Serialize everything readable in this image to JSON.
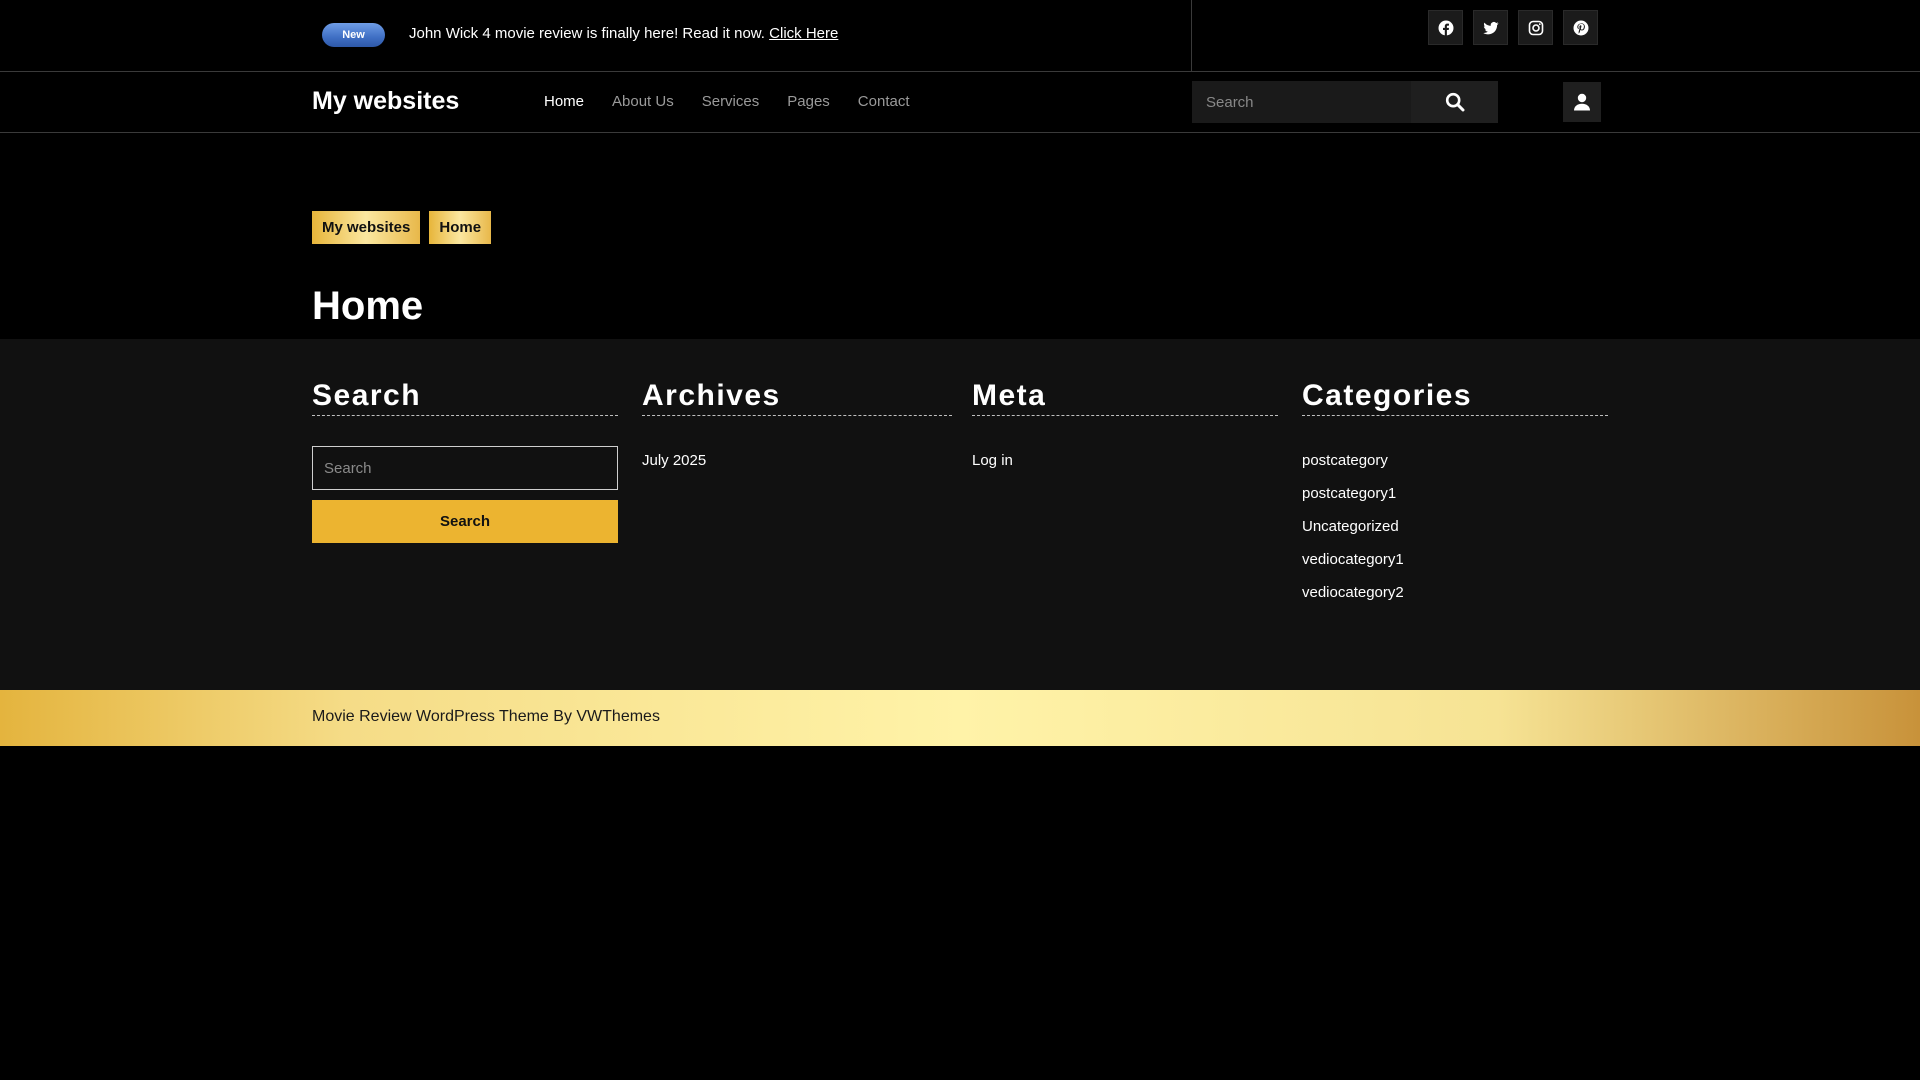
{
  "announcement": {
    "badge": "New",
    "text": "John Wick 4 movie review is finally here! Read it now.",
    "link": "Click Here"
  },
  "socials": [
    "facebook-icon",
    "twitter-icon",
    "instagram-icon",
    "pinterest-icon"
  ],
  "header": {
    "site_title": "My websites",
    "nav": [
      "Home",
      "About Us",
      "Services",
      "Pages",
      "Contact"
    ],
    "active_nav": "Home",
    "search_placeholder": "Search"
  },
  "breadcrumb": [
    "My websites",
    "Home"
  ],
  "page_title": "Home",
  "widgets": {
    "search": {
      "title": "Search",
      "placeholder": "Search",
      "button": "Search"
    },
    "archives": {
      "title": "Archives",
      "items": [
        "July 2025"
      ]
    },
    "meta": {
      "title": "Meta",
      "items": [
        "Log in"
      ]
    },
    "categories": {
      "title": "Categories",
      "items": [
        "postcategory",
        "postcategory1",
        "Uncategorized",
        "vediocategory1",
        "vediocategory2"
      ]
    }
  },
  "footer": {
    "text": "Movie Review WordPress Theme By VWThemes"
  },
  "colors": {
    "accent": "#ecb430",
    "badge": "#4a7bd0",
    "background": "#000000",
    "widget_bg": "#111111"
  }
}
